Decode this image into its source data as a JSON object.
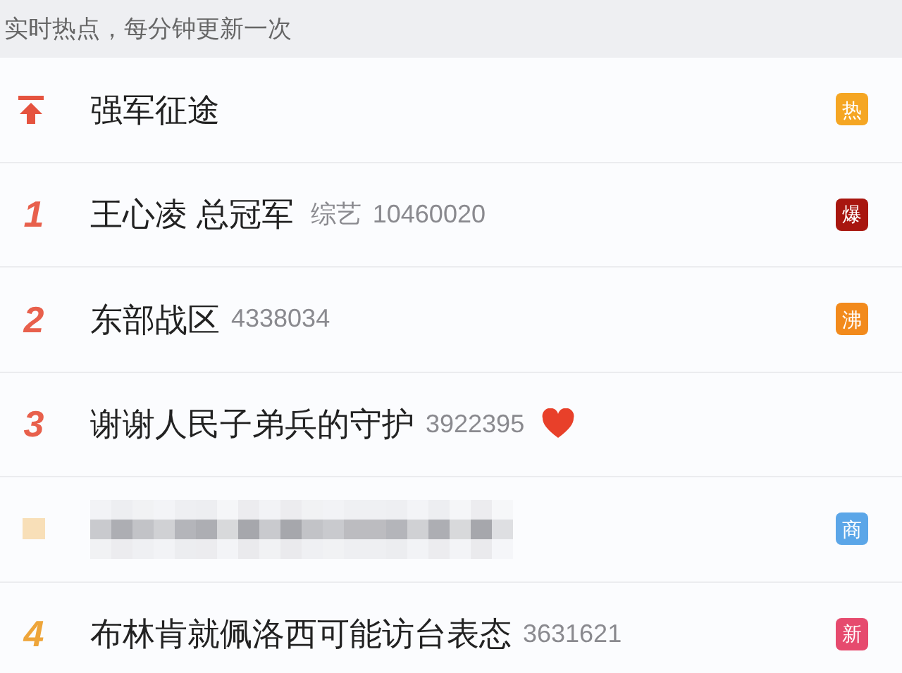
{
  "header": {
    "text": "实时热点，每分钟更新一次"
  },
  "rows": [
    {
      "kind": "pinned",
      "title": "强军征途",
      "badge": {
        "text": "热",
        "color": "#f5a623"
      }
    },
    {
      "kind": "ranked",
      "rank": "1",
      "top3": true,
      "title": "王心凌 总冠军",
      "category": "综艺",
      "count": "10460020",
      "badge": {
        "text": "爆",
        "color": "#a8160f"
      }
    },
    {
      "kind": "ranked",
      "rank": "2",
      "top3": true,
      "title": "东部战区",
      "count": "4338034",
      "badge": {
        "text": "沸",
        "color": "#f28a1c"
      }
    },
    {
      "kind": "ranked",
      "rank": "3",
      "top3": true,
      "title": "谢谢人民子弟兵的守护",
      "count": "3922395",
      "heart": true
    },
    {
      "kind": "ad",
      "badge": {
        "text": "商",
        "color": "#5ba6e8"
      }
    },
    {
      "kind": "ranked",
      "rank": "4",
      "top3": false,
      "title": "布林肯就佩洛西可能访台表态",
      "count": "3631621",
      "badge": {
        "text": "新",
        "color": "#e64a6e"
      }
    }
  ]
}
